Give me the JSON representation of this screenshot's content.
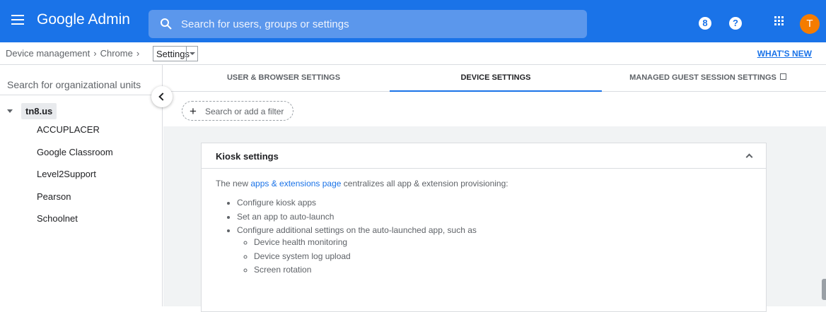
{
  "topbar": {
    "brand": "Google Admin",
    "search_placeholder": "Search for users, groups or settings",
    "support_badge": "8",
    "help_icon": "?",
    "avatar_initial": "T"
  },
  "breadcrumb": {
    "items": [
      "Device management",
      "Chrome"
    ],
    "current": "Settings",
    "whats_new": "WHAT'S NEW"
  },
  "sidebar": {
    "search_placeholder": "Search for organizational units",
    "root": "tn8.us",
    "children": [
      "ACCUPLACER",
      "Google Classroom",
      "Level2Support",
      "Pearson",
      "Schoolnet"
    ]
  },
  "tabs": [
    {
      "label": "USER & BROWSER SETTINGS",
      "active": false
    },
    {
      "label": "DEVICE SETTINGS",
      "active": true
    },
    {
      "label": "MANAGED GUEST SESSION SETTINGS",
      "active": false
    }
  ],
  "filter": {
    "label": "Search or add a filter"
  },
  "card": {
    "title": "Kiosk settings",
    "lead_prefix": "The new ",
    "lead_link": "apps & extensions page",
    "lead_suffix": " centralizes all app & extension provisioning:",
    "bullets": [
      "Configure kiosk apps",
      "Set an app to auto-launch",
      "Configure additional settings on the auto-launched app, such as"
    ],
    "sub_bullets": [
      "Device health monitoring",
      "Device system log upload",
      "Screen rotation"
    ]
  },
  "colors": {
    "brand_blue": "#1a73e8",
    "avatar": "#f57c00",
    "panel_bg": "#f1f3f4"
  }
}
